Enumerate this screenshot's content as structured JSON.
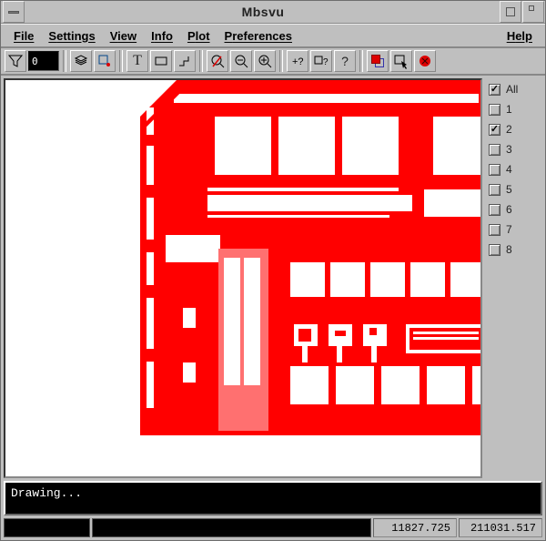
{
  "window": {
    "title": "Mbsvu"
  },
  "menu": {
    "file": "File",
    "settings": "Settings",
    "view": "View",
    "info": "Info",
    "plot": "Plot",
    "preferences": "Preferences",
    "help": "Help"
  },
  "toolbar": {
    "current_layer": "0",
    "icons": {
      "filter": "filter-icon",
      "layers": "layers-icon",
      "select-box": "select-box-icon",
      "text": "text-icon",
      "rect": "rect-icon",
      "step": "step-icon",
      "zoom-cancel": "zoom-cancel-icon",
      "zoom-out": "zoom-out-icon",
      "zoom-in": "zoom-in-icon",
      "help-plus": "help-plus-icon",
      "help-rect": "help-rect-icon",
      "help": "help-icon",
      "red-over-blue": "red-over-blue-icon",
      "select-arrow": "select-arrow-icon",
      "close-red": "close-red-icon"
    }
  },
  "layers": {
    "all_label": "All",
    "all_checked": true,
    "items": [
      {
        "label": "1",
        "checked": false
      },
      {
        "label": "2",
        "checked": true
      },
      {
        "label": "3",
        "checked": false
      },
      {
        "label": "4",
        "checked": false
      },
      {
        "label": "5",
        "checked": false
      },
      {
        "label": "6",
        "checked": false
      },
      {
        "label": "7",
        "checked": false
      },
      {
        "label": "8",
        "checked": false
      }
    ]
  },
  "console": {
    "message": "Drawing..."
  },
  "status": {
    "coord_x": "11827.725",
    "coord_y": "211031.517"
  },
  "colors": {
    "design": "#ff0000",
    "background": "#bfbfbf",
    "console": "#000000"
  },
  "chart_data": {
    "type": "table",
    "note": "IC layout view; no numeric chart data, only geometry preview of layer 2 in red on white."
  }
}
